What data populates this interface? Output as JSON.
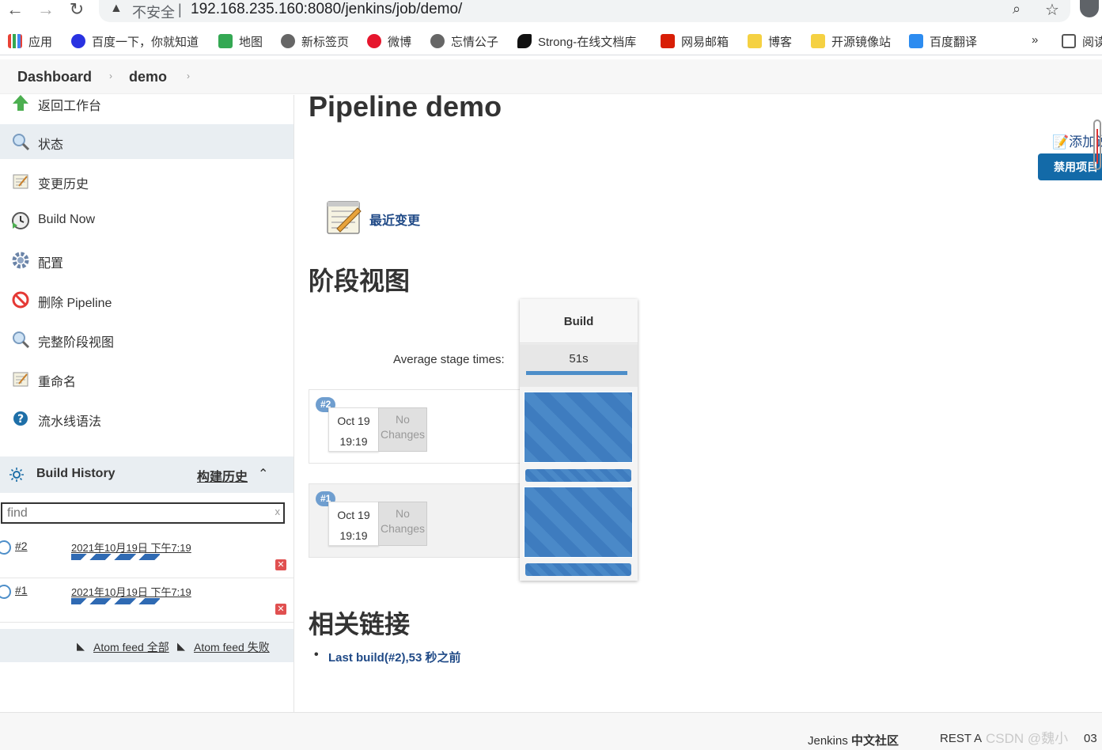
{
  "browser": {
    "insecure_label": "不安全",
    "url": "192.168.235.160:8080/jenkins/job/demo/",
    "bookmarks": [
      "应用",
      "百度一下，你就知道",
      "地图",
      "新标签页",
      "微博",
      "忘情公子",
      "Strong-在线文档库",
      "网易邮箱",
      "博客",
      "开源镜像站",
      "百度翻译"
    ],
    "more": "»",
    "reading_list": "阅读"
  },
  "breadcrumb": {
    "dashboard": "Dashboard",
    "job": "demo"
  },
  "sidebar": {
    "tasks": [
      "返回工作台",
      "状态",
      "变更历史",
      "Build Now",
      "配置",
      "删除 Pipeline",
      "完整阶段视图",
      "重命名",
      "流水线语法"
    ]
  },
  "build_history": {
    "title": "Build History",
    "trend": "构建历史",
    "find_placeholder": "find",
    "clear": "x",
    "builds": [
      {
        "num": "#2",
        "date": "2021年10月19日 下午7:19"
      },
      {
        "num": "#1",
        "date": "2021年10月19日 下午7:19"
      }
    ],
    "feed_all": "Atom feed 全部",
    "feed_fail": "Atom feed 失败"
  },
  "main": {
    "title": "Pipeline demo",
    "add_description": "添加说明",
    "disable_project": "禁用项目",
    "recent_changes": "最近变更",
    "stage_view_heading": "阶段视图",
    "stage_name": "Build",
    "avg_label": "Average stage times:",
    "avg_time": "51s",
    "runs": [
      {
        "badge": "#2",
        "date": "Oct 19",
        "time": "19:19",
        "changes": "No Changes"
      },
      {
        "badge": "#1",
        "date": "Oct 19",
        "time": "19:19",
        "changes": "No Changes"
      }
    ],
    "links_heading": "相关链接",
    "last_build": "Last build(#2),53 秒之前"
  },
  "footer": {
    "community_prefix": "Jenkins ",
    "community_bold": "中文社区",
    "rest": "REST A",
    "watermark": "CSDN @魏小",
    "version": "03"
  },
  "colors": {
    "jenkins_blue": "#136aa8",
    "link": "#204a87",
    "stage_blue": "#4a89c8"
  }
}
